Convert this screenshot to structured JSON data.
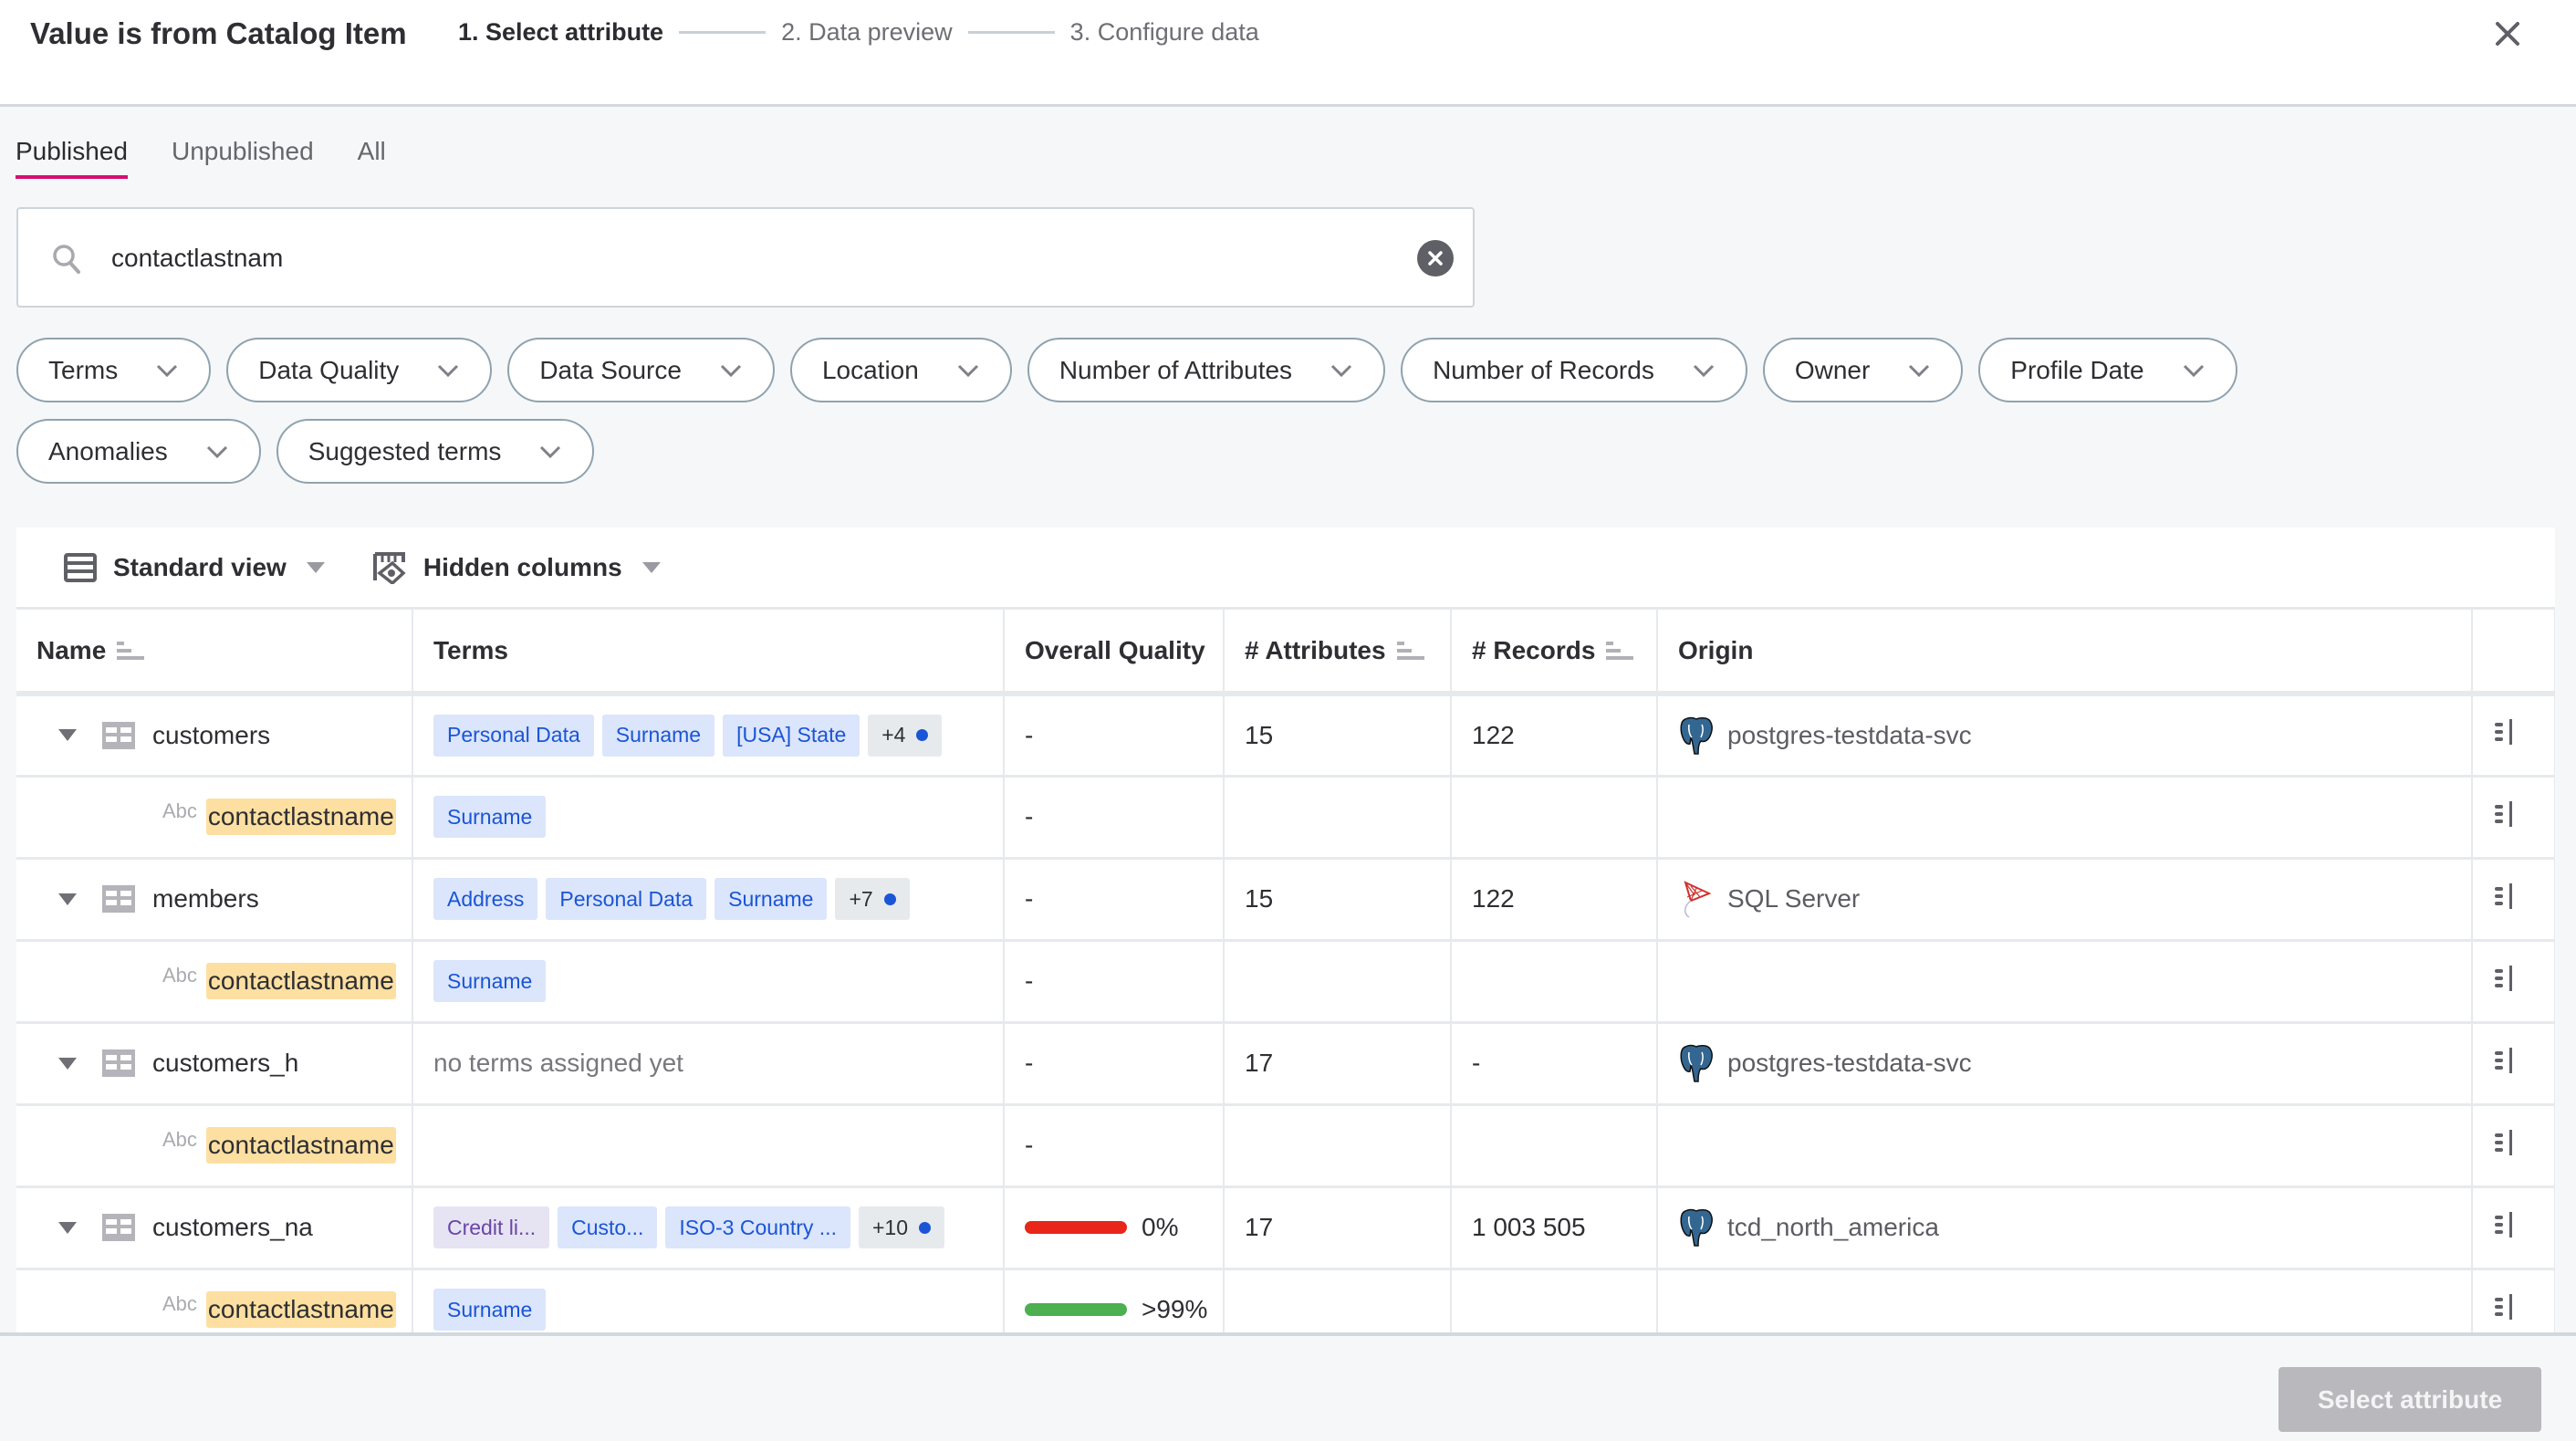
{
  "header": {
    "title": "Value is from Catalog Item",
    "steps": [
      {
        "label": "1. Select attribute",
        "active": true
      },
      {
        "label": "2. Data preview",
        "active": false
      },
      {
        "label": "3. Configure data",
        "active": false
      }
    ],
    "close_icon": "close-icon"
  },
  "tabs": [
    {
      "label": "Published",
      "active": true
    },
    {
      "label": "Unpublished",
      "active": false
    },
    {
      "label": "All",
      "active": false
    }
  ],
  "search": {
    "value": "contactlastnam",
    "icon": "search-icon",
    "clear_icon": "clear-icon"
  },
  "filters": [
    "Terms",
    "Data Quality",
    "Data Source",
    "Location",
    "Number of Attributes",
    "Number of Records",
    "Owner",
    "Profile Date",
    "Anomalies",
    "Suggested terms"
  ],
  "toolbar": {
    "view_label": "Standard view",
    "hidden_columns_label": "Hidden columns"
  },
  "table": {
    "columns": {
      "name": "Name",
      "terms": "Terms",
      "quality": "Overall Quality",
      "attributes": "# Attributes",
      "records": "# Records",
      "origin": "Origin"
    },
    "rows": [
      {
        "type": "table",
        "name": "customers",
        "terms": [
          "Personal Data",
          "Surname",
          "[USA] State"
        ],
        "more": "+4",
        "quality": "-",
        "attributes": "15",
        "records": "122",
        "origin": "postgres-testdata-svc",
        "origin_icon": "postgresql-icon"
      },
      {
        "type": "attribute",
        "type_label": "Abc",
        "name": "contactlastname",
        "terms": [
          "Surname"
        ],
        "quality": "-"
      },
      {
        "type": "table",
        "name": "members",
        "terms": [
          "Address",
          "Personal Data",
          "Surname"
        ],
        "more": "+7",
        "quality": "-",
        "attributes": "15",
        "records": "122",
        "origin": "SQL Server",
        "origin_icon": "sql-server-icon"
      },
      {
        "type": "attribute",
        "type_label": "Abc",
        "name": "contactlastname",
        "terms": [
          "Surname"
        ],
        "quality": "-"
      },
      {
        "type": "table",
        "name": "customers_h",
        "no_terms": "no terms assigned yet",
        "quality": "-",
        "attributes": "17",
        "records": "-",
        "origin": "postgres-testdata-svc",
        "origin_icon": "postgresql-icon"
      },
      {
        "type": "attribute",
        "type_label": "Abc",
        "name": "contactlastname",
        "quality": "-"
      },
      {
        "type": "table",
        "name": "customers_na",
        "terms": [
          "Credit li...",
          "Custo...",
          "ISO-3 Country ..."
        ],
        "more": "+10",
        "quality_label": "0%",
        "quality_pct": 0,
        "quality_color": "#e8261a",
        "attributes": "17",
        "records": "1 003 505",
        "origin": "tcd_north_america",
        "origin_icon": "postgresql-icon"
      },
      {
        "type": "attribute",
        "type_label": "Abc",
        "name": "contactlastname",
        "terms": [
          "Surname"
        ],
        "quality_label": ">99%",
        "quality_pct": 99,
        "quality_color": "#4caf50"
      }
    ]
  },
  "footer": {
    "select_label": "Select attribute"
  },
  "colors": {
    "accent": "#d50f71",
    "tag_bg": "#dbe5fb",
    "tag_text": "#1a55d6",
    "highlight": "#fde0a1",
    "disabled_button": "#b8b8bd"
  }
}
